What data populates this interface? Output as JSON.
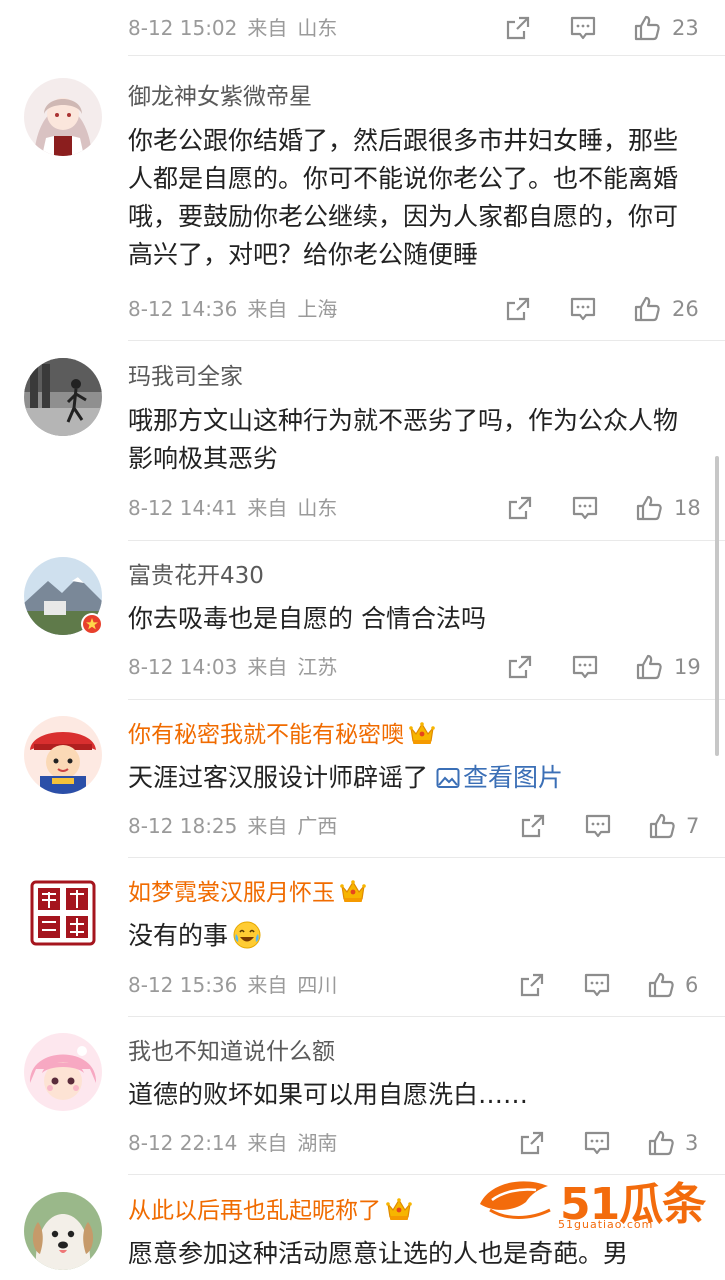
{
  "comments": [
    {
      "date": "8-12 15:02",
      "from": "来自",
      "location": "山东",
      "likes": "23"
    },
    {
      "username": "御龙神女紫微帝星",
      "text": "你老公跟你结婚了，然后跟很多市井妇女睡，那些人都是自愿的。你可不能说你老公了。也不能离婚哦，要鼓励你老公继续，因为人家都自愿的，你可高兴了，对吧？给你老公随便睡",
      "date": "8-12 14:36",
      "from": "来自",
      "location": "上海",
      "likes": "26"
    },
    {
      "username": "玛我司全家",
      "text": "哦那方文山这种行为就不恶劣了吗，作为公众人物影响极其恶劣",
      "date": "8-12 14:41",
      "from": "来自",
      "location": "山东",
      "likes": "18"
    },
    {
      "username": "富贵花开430",
      "text": "你去吸毒也是自愿的 合情合法吗",
      "date": "8-12 14:03",
      "from": "来自",
      "location": "江苏",
      "likes": "19"
    },
    {
      "username": "你有秘密我就不能有秘密噢",
      "text": "天涯过客汉服设计师辟谣了",
      "link": "查看图片",
      "date": "8-12 18:25",
      "from": "来自",
      "location": "广西",
      "likes": "7"
    },
    {
      "username": "如梦霓裳汉服月怀玉",
      "text": "没有的事",
      "date": "8-12 15:36",
      "from": "来自",
      "location": "四川",
      "likes": "6"
    },
    {
      "username": "我也不知道说什么额",
      "text": "道德的败坏如果可以用自愿洗白……",
      "date": "8-12 22:14",
      "from": "来自",
      "location": "湖南",
      "likes": "3"
    },
    {
      "username": "从此以后再也乱起昵称了",
      "text": "愿意参加这种活动愿意让选的人也是奇葩。男"
    }
  ],
  "watermark": {
    "brand": "51瓜条",
    "url": "51guatiao.com"
  },
  "colors": {
    "vip_name": "#f06b00",
    "link": "#3b6fb6",
    "meta": "#9a9a9a",
    "divider": "#e9e9e9"
  },
  "icons": [
    "share-icon",
    "comment-icon",
    "like-icon",
    "crown-icon",
    "image-icon",
    "laugh-cry-emoji",
    "verified-badge-icon"
  ]
}
